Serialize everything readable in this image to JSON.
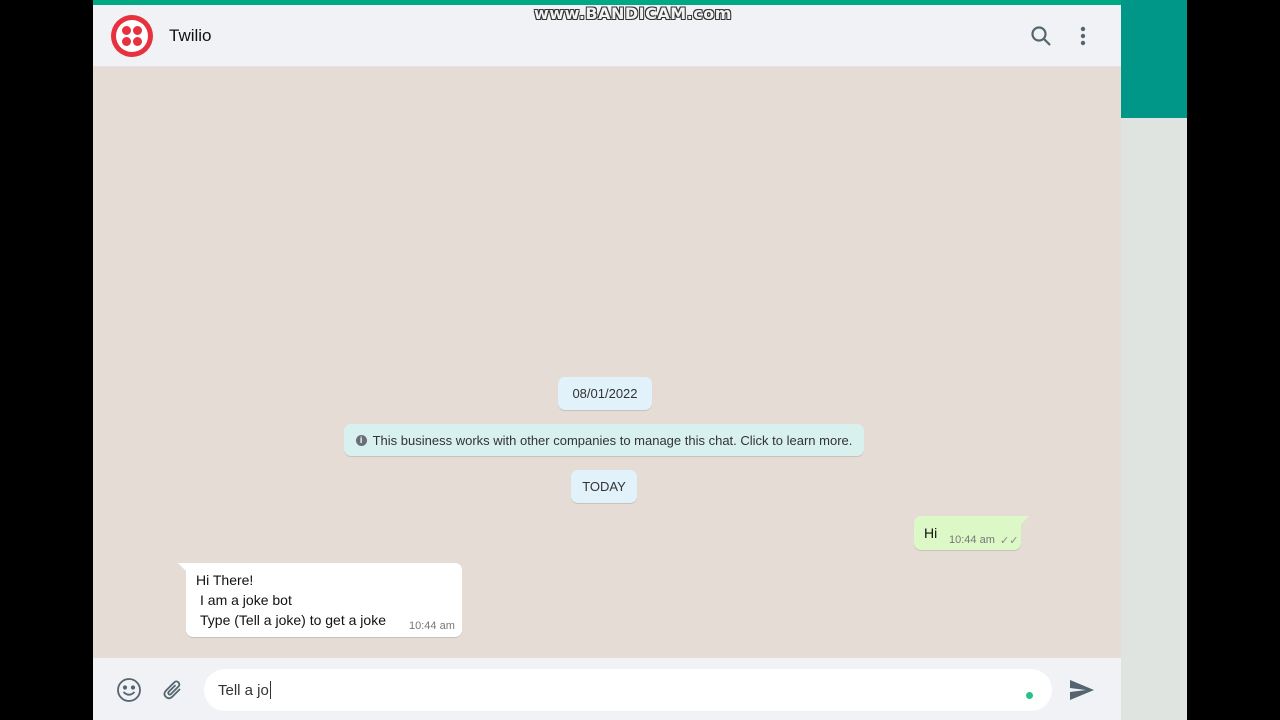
{
  "watermark": "www.BANDICAM.com",
  "header": {
    "title": "Twilio",
    "logo": "twilio-logo",
    "icons": [
      "search-icon",
      "more-vertical-icon"
    ]
  },
  "chat": {
    "date_pill": "08/01/2022",
    "notice": "This business works with other companies to manage this chat. Click to learn more.",
    "today_pill": "TODAY",
    "messages": [
      {
        "direction": "outgoing",
        "text": "Hi",
        "time": "10:44 am",
        "status": "read-double-tick"
      },
      {
        "direction": "incoming",
        "lines": [
          "Hi There!",
          "I am a joke bot",
          "Type (Tell a joke) to get a joke"
        ],
        "time": "10:44 am"
      }
    ]
  },
  "composer": {
    "value": "Tell a jo",
    "icons": [
      "emoji-icon",
      "attach-icon",
      "send-icon"
    ]
  },
  "colors": {
    "brand": "#e8313e",
    "outgoing_bubble": "#dcf8c6",
    "incoming_bubble": "#ffffff",
    "teal": "#009688",
    "chat_bg": "#e5ddd5"
  }
}
